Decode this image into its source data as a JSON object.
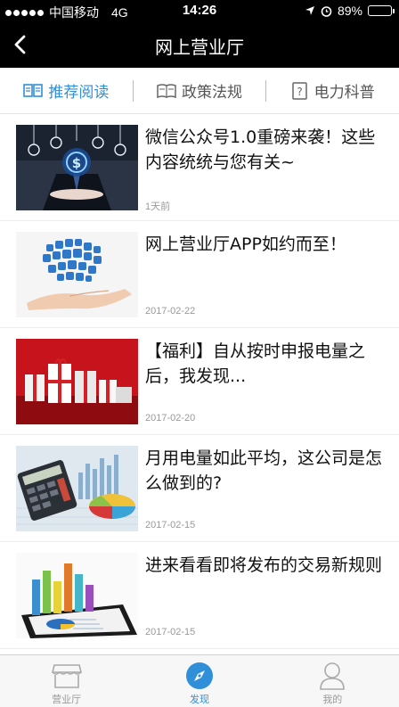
{
  "status_bar": {
    "carrier": "中国移动",
    "network": "4G",
    "time": "14:26",
    "battery": "89%",
    "battery_level": 0.89
  },
  "nav": {
    "title": "网上营业厅",
    "back_icon": "chevron-left-icon"
  },
  "tabs": [
    {
      "label": "推荐阅读",
      "icon": "open-book-icon",
      "active": true
    },
    {
      "label": "政策法规",
      "icon": "law-book-icon",
      "active": false
    },
    {
      "label": "电力科普",
      "icon": "question-book-icon",
      "active": false
    }
  ],
  "articles": [
    {
      "title": "微信公众号1.0重磅来袭！这些内容统统与您有关~",
      "date": "1天前"
    },
    {
      "title": "网上营业厅APP如约而至！",
      "date": "2017-02-22"
    },
    {
      "title": "【福利】自从按时申报电量之后，我发现...",
      "date": "2017-02-20"
    },
    {
      "title": "月用电量如此平均，这公司是怎么做到的?",
      "date": "2017-02-15"
    },
    {
      "title": "进来看看即将发布的交易新规则",
      "date": "2017-02-15"
    }
  ],
  "tabbar": [
    {
      "label": "营业厅",
      "icon": "storefront-icon",
      "active": false
    },
    {
      "label": "发现",
      "icon": "compass-icon",
      "active": true
    },
    {
      "label": "我的",
      "icon": "user-icon",
      "active": false
    }
  ],
  "colors": {
    "accent": "#2f8fd8",
    "header_bg": "#000000",
    "battery_green": "#4cd964"
  }
}
